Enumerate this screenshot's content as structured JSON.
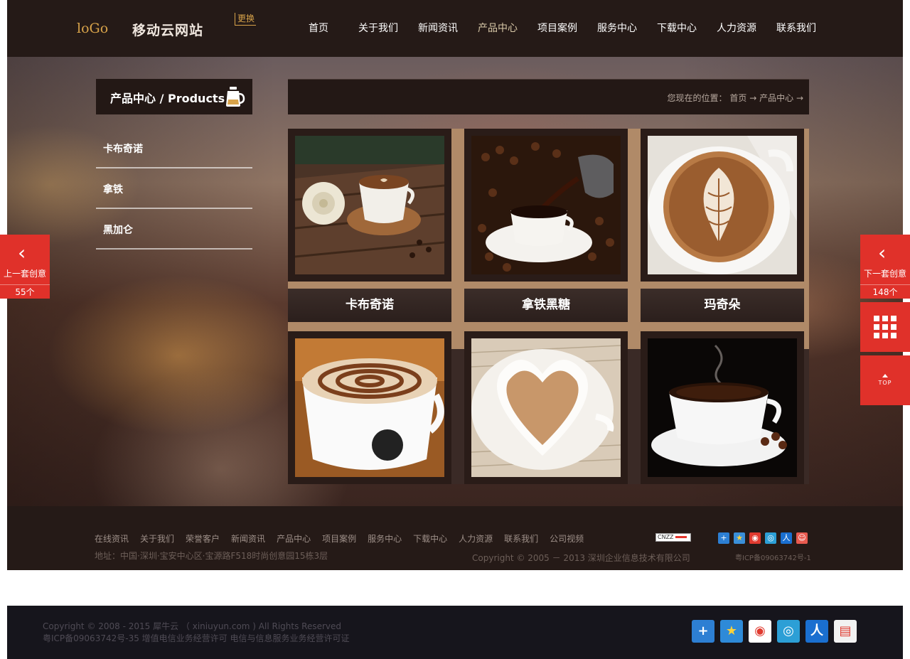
{
  "header": {
    "logo_mark": "loGo",
    "logo_text": "移动云网站",
    "logo_change": "更换",
    "nav": [
      {
        "label": "首页"
      },
      {
        "label": "关于我们"
      },
      {
        "label": "新闻资讯"
      },
      {
        "label": "产品中心",
        "active": true
      },
      {
        "label": "项目案例"
      },
      {
        "label": "服务中心"
      },
      {
        "label": "下载中心"
      },
      {
        "label": "人力资源"
      },
      {
        "label": "联系我们"
      }
    ]
  },
  "sidebar": {
    "title": "产品中心 / Products",
    "icon": "coffee-pot-icon",
    "items": [
      {
        "label": "卡布奇诺"
      },
      {
        "label": "拿铁"
      },
      {
        "label": "黑加仑"
      }
    ]
  },
  "breadcrumb": {
    "prefix": "您现在的位置：",
    "home": "首页",
    "sep": "→",
    "current": "产品中心",
    "trail_end": "→"
  },
  "products": [
    {
      "name": "卡布奇诺",
      "image": "latte-heart-with-rose"
    },
    {
      "name": "拿铁黑糖",
      "image": "pouring-coffee-beans"
    },
    {
      "name": "玛奇朵",
      "image": "latte-art-leaf"
    },
    {
      "name": "",
      "image": "cappuccino-flower-art"
    },
    {
      "name": "",
      "image": "heart-cup-milk-coffee"
    },
    {
      "name": "",
      "image": "steaming-black-coffee"
    }
  ],
  "float_nav": {
    "prev": {
      "label": "上一套创意",
      "count": "55个"
    },
    "next": {
      "label": "下一套创意",
      "count": "148个"
    },
    "top_label": "TOP"
  },
  "site_footer": {
    "links": [
      "在线资讯",
      "关于我们",
      "荣誉客户",
      "新闻资讯",
      "产品中心",
      "项目案例",
      "服务中心",
      "下载中心",
      "人力资源",
      "联系我们",
      "公司视频"
    ],
    "address": "地址：中国·深圳·宝安中心区·宝源路F518时尚创意园15栋3层",
    "copyright": "Copyright © 2005 － 2013  深圳企业信息技术有限公司",
    "icp": "粤ICP备09063742号-1",
    "cnzz": "CNZZ"
  },
  "page_footer": {
    "copyright": "Copyright © 2008 - 2015 犀牛云 （ xiniuyun.com ) All Rights Reserved",
    "license": "粤ICP备09063742号-35 增值电信业务经营许可 电信与信息服务业务经营许可证"
  },
  "colors": {
    "accent_red": "#e0312a",
    "dark_bg": "#231815",
    "gold": "#d8a34a"
  }
}
